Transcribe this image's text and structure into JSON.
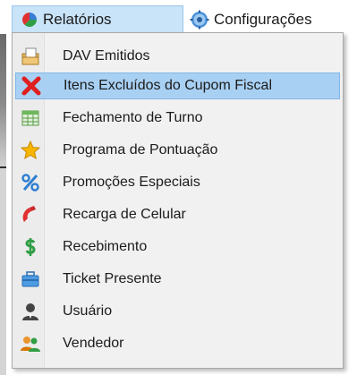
{
  "menubar": {
    "relatorios": {
      "label": "Relatórios",
      "icon": "pie-chart-icon"
    },
    "configuracoes": {
      "label": "Configurações",
      "icon": "gear-icon"
    }
  },
  "menu": {
    "items": [
      {
        "label": "DAV Emitidos",
        "icon": "document-folder-icon"
      },
      {
        "label": "Itens Excluídos do Cupom Fiscal",
        "icon": "red-x-icon",
        "selected": true
      },
      {
        "label": "Fechamento de Turno",
        "icon": "calendar-grid-icon"
      },
      {
        "label": "Programa de Pontuação",
        "icon": "star-icon"
      },
      {
        "label": "Promoções Especiais",
        "icon": "percent-icon"
      },
      {
        "label": "Recarga de Celular",
        "icon": "phone-handset-icon"
      },
      {
        "label": "Recebimento",
        "icon": "dollar-icon"
      },
      {
        "label": "Ticket Presente",
        "icon": "briefcase-icon"
      },
      {
        "label": "Usuário",
        "icon": "user-icon"
      },
      {
        "label": "Vendedor",
        "icon": "users-icon"
      }
    ]
  },
  "colors": {
    "highlight": "#a8d0f3",
    "menu_active": "#c9e3f8"
  }
}
